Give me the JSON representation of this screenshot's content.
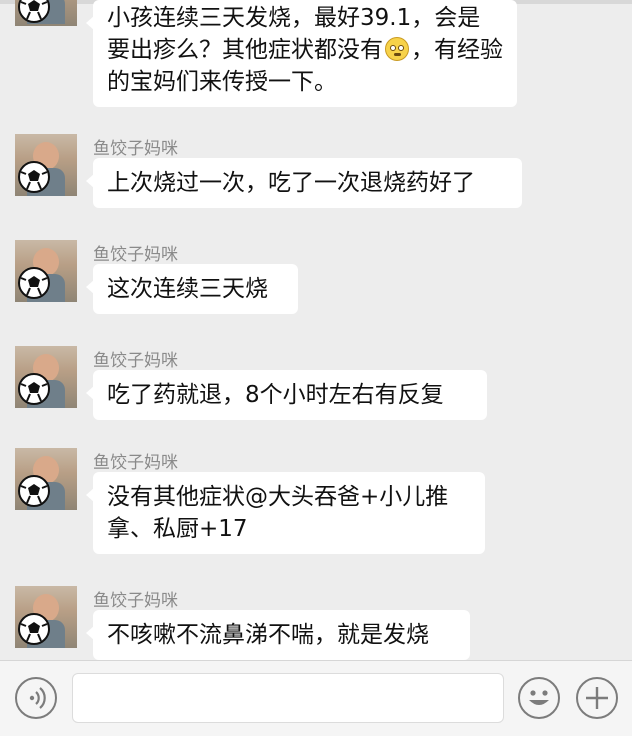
{
  "messages": [
    {
      "sender": "",
      "text_parts": [
        "小孩连续三天发烧，最好39.1，会是要出疹么？其他症状都没有",
        "，有经验的宝妈们来传授一下。"
      ],
      "emoji": "awkward-smile-emoji"
    },
    {
      "sender": "鱼饺子妈咪",
      "text": "上次烧过一次，吃了一次退烧药好了"
    },
    {
      "sender": "鱼饺子妈咪",
      "text": "这次连续三天烧"
    },
    {
      "sender": "鱼饺子妈咪",
      "text": "吃了药就退，8个小时左右有反复"
    },
    {
      "sender": "鱼饺子妈咪",
      "text": "没有其他症状@大头吞爸+小儿推拿、私厨+17"
    },
    {
      "sender": "鱼饺子妈咪",
      "text": "不咳嗽不流鼻涕不喘，就是发烧"
    }
  ],
  "toolbar": {
    "voice_icon": "voice-input-icon",
    "emoji_icon": "emoji-icon",
    "plus_icon": "plus-icon"
  },
  "colors": {
    "background": "#ededed",
    "bubble": "#ffffff",
    "sender_name": "#8a8a8a"
  }
}
